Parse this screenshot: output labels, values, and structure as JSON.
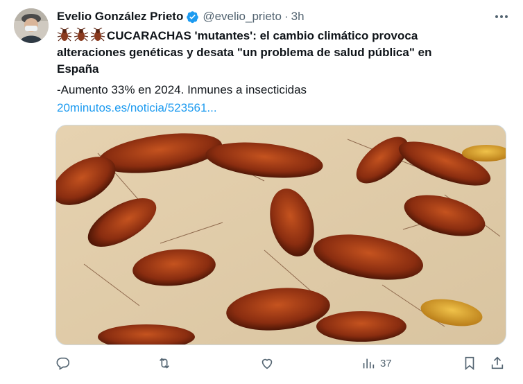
{
  "tweet": {
    "author_name": "Evelio González Prieto",
    "handle": "@evelio_prieto",
    "separator": "·",
    "time": "3h",
    "title_text": "CUCARACHAS 'mutantes': el cambio climático provoca alteraciones genéticas y desata \"un problema de salud pública\" en España",
    "title_emoji": [
      "cockroach-emoji",
      "cockroach-emoji",
      "cockroach-emoji"
    ],
    "subline": "-Aumento 33% en 2024. Inmunes a insecticidas",
    "link_text": "20minutos.es/noticia/523561..."
  },
  "actions": {
    "reply_icon": "reply-icon",
    "retweet_icon": "retweet-icon",
    "like_icon": "heart-icon",
    "views_icon": "views-icon",
    "views_count": "37",
    "bookmark_icon": "bookmark-icon",
    "share_icon": "share-icon"
  },
  "colors": {
    "text": "#0f1419",
    "secondary": "#536471",
    "link": "#1d9bf0",
    "verified": "#1d9bf0",
    "border": "#cfd9de"
  }
}
